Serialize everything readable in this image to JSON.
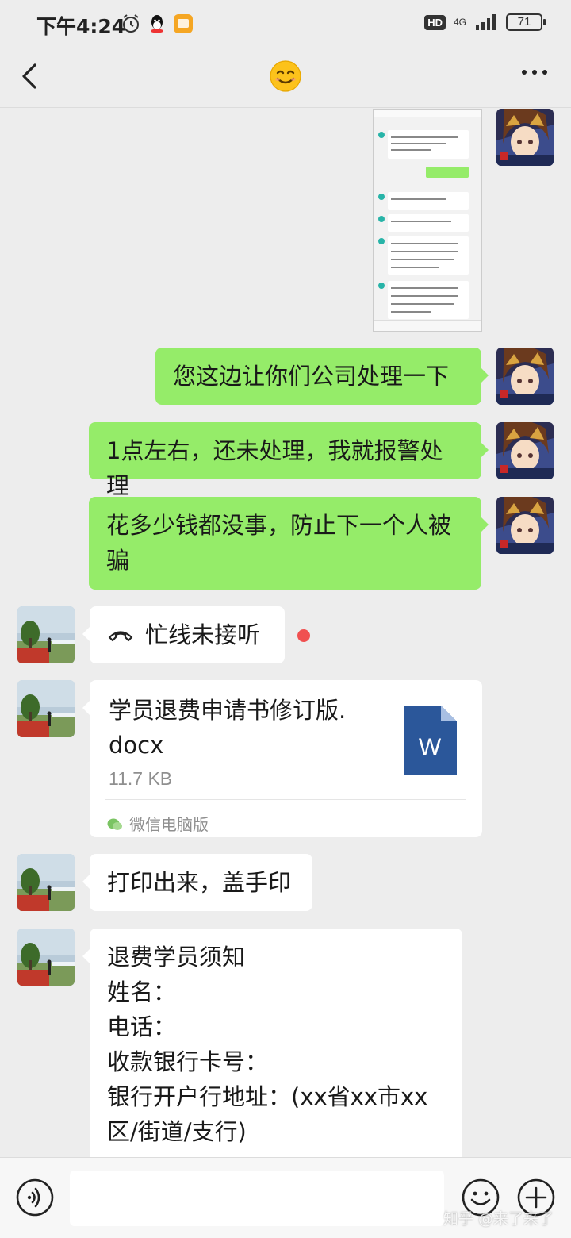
{
  "status_bar": {
    "time": "下午4:24",
    "hd": "HD",
    "network": "4G",
    "battery": "71"
  },
  "nav": {
    "title_icon": "smiling-face-emoji",
    "back_icon": "chevron-left-icon",
    "more_icon": "more-dots-icon"
  },
  "messages": [
    {
      "side": "me",
      "type": "image",
      "kind": "chat-screenshot-thumbnail"
    },
    {
      "side": "me",
      "type": "text",
      "text": "您这边让你们公司处理一下"
    },
    {
      "side": "me",
      "type": "text",
      "text": "1点左右，还未处理，我就报警处理"
    },
    {
      "side": "me",
      "type": "text",
      "lines": [
        "花多少钱都没事，防止下一个人被",
        "骗"
      ]
    },
    {
      "side": "other",
      "type": "call",
      "text": "忙线未接听",
      "unread": true
    },
    {
      "side": "other",
      "type": "file",
      "name_lines": [
        "学员退费申请书修订版.",
        "docx"
      ],
      "size": "11.7 KB",
      "source": "微信电脑版",
      "file_icon": "word-document-icon"
    },
    {
      "side": "other",
      "type": "text",
      "text": "打印出来，盖手印"
    },
    {
      "side": "other",
      "type": "text",
      "lines": [
        "退费学员须知",
        "姓名：",
        "电话：",
        "收款银行卡号：",
        "银行开户行地址：(xx省xx市xx",
        "区/街道/支行)"
      ]
    }
  ],
  "input_bar": {
    "voice_icon": "voice-icon",
    "emoji_icon": "emoji-icon",
    "plus_icon": "plus-icon",
    "watermark": "知乎 @来了来了"
  },
  "colors": {
    "background": "#ededed",
    "my_bubble": "#95ec69",
    "other_bubble": "#ffffff",
    "missed_dot": "#f05050",
    "word_blue": "#2b579a"
  }
}
